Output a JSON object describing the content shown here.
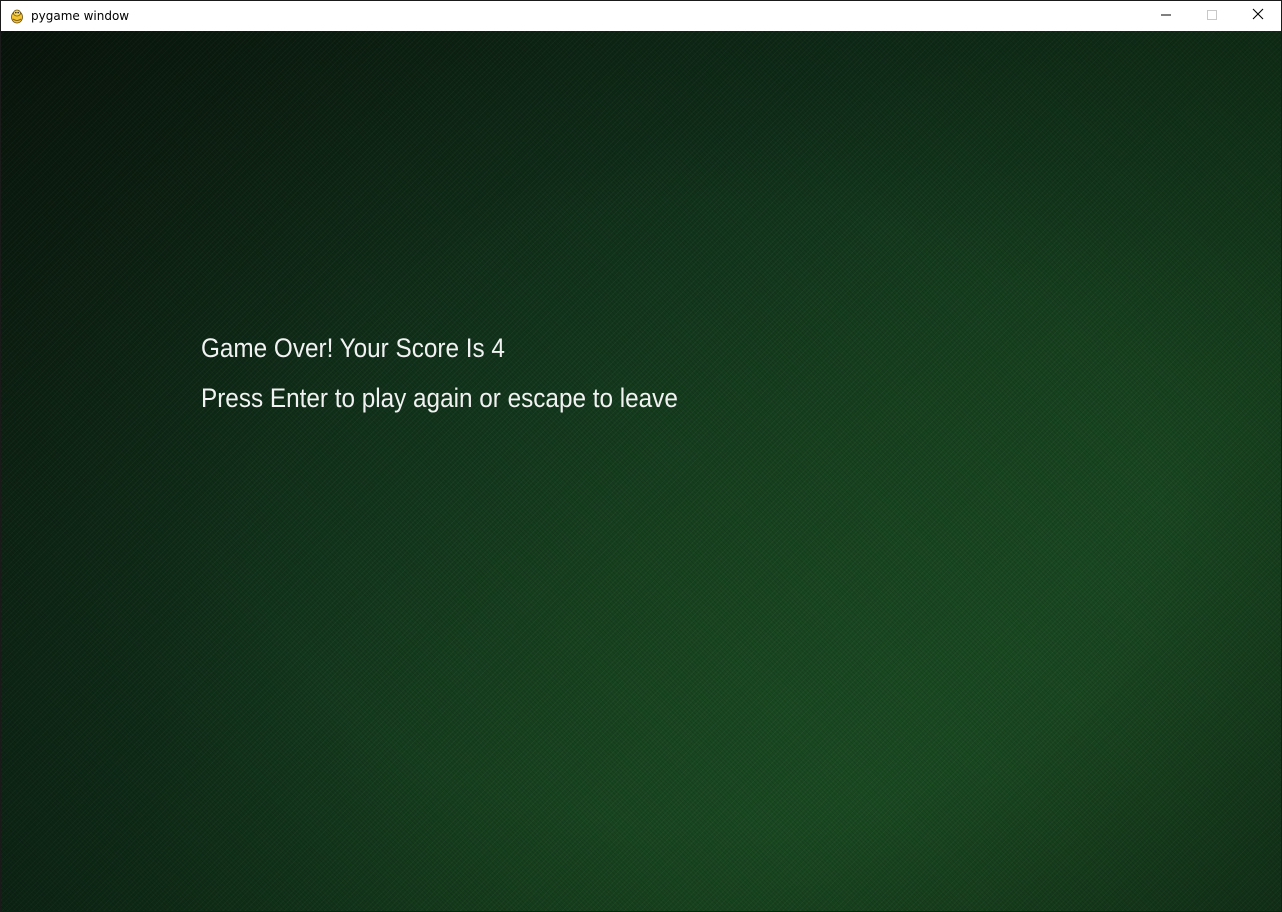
{
  "window": {
    "title": "pygame window",
    "icon": "pygame-snake-icon"
  },
  "controls": {
    "minimize_icon": "minimize-icon",
    "maximize_icon": "maximize-icon",
    "close_icon": "close-icon"
  },
  "game": {
    "score_text": "Game Over! Your Score Is 4",
    "prompt_text": "Press Enter to play again or escape to leave"
  },
  "colors": {
    "background": "#123a1a",
    "text": "#f2f2f2"
  }
}
